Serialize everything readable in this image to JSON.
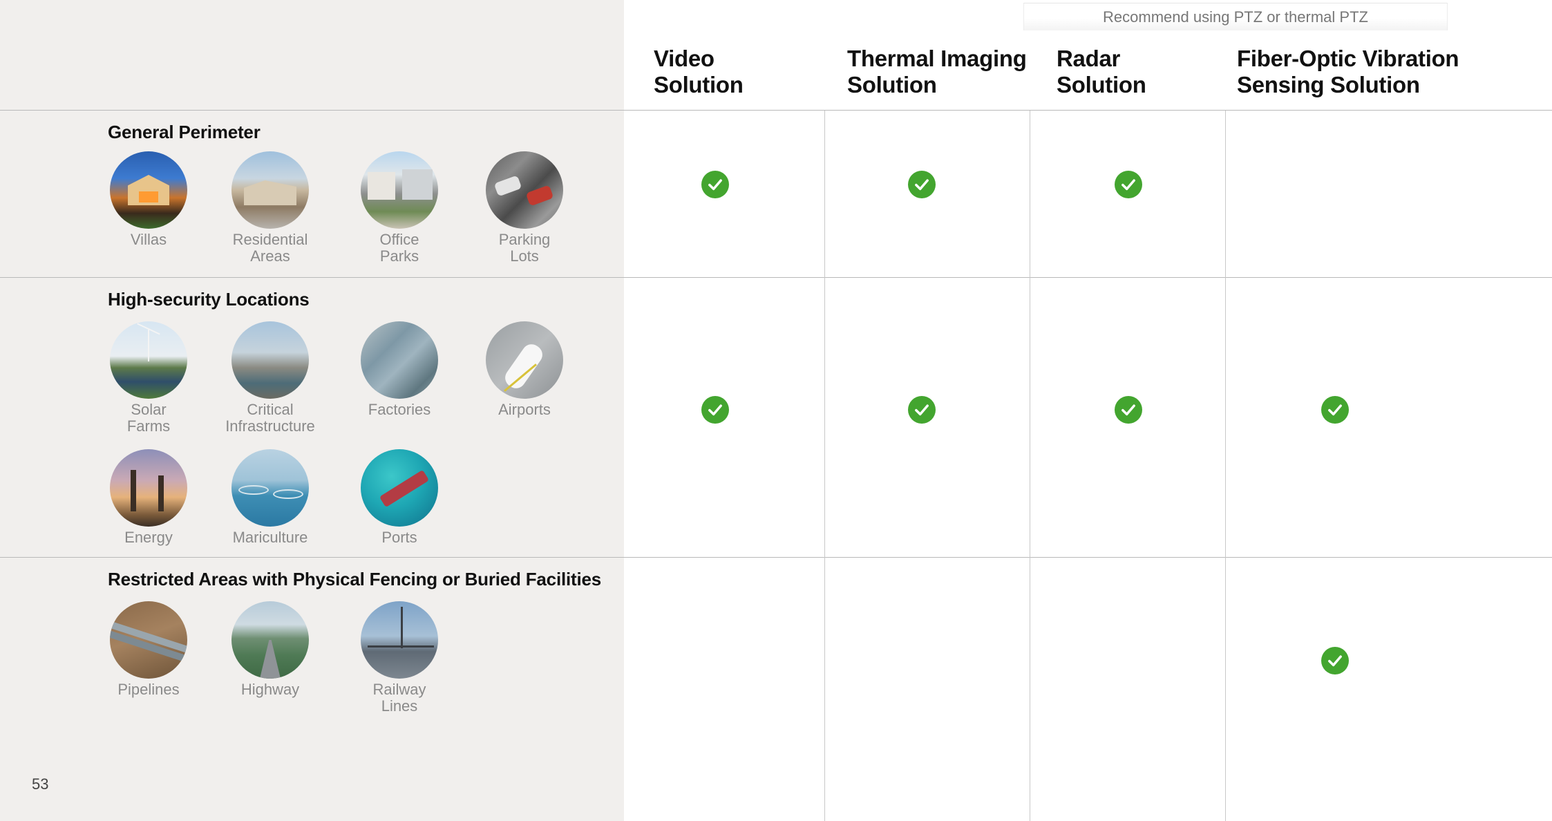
{
  "note": "Recommend using PTZ or thermal PTZ",
  "columns": [
    {
      "line1": "Video",
      "line2": "Solution"
    },
    {
      "line1": "Thermal Imaging",
      "line2": "Solution"
    },
    {
      "line1": "Radar",
      "line2": "Solution"
    },
    {
      "line1": "Fiber-Optic Vibration",
      "line2": "Sensing Solution"
    }
  ],
  "sections": [
    {
      "title": "General Perimeter",
      "places": [
        {
          "line1": "Villas",
          "line2": ""
        },
        {
          "line1": "Residential",
          "line2": "Areas"
        },
        {
          "line1": "Office",
          "line2": "Parks"
        },
        {
          "line1": "Parking",
          "line2": "Lots"
        }
      ],
      "support": [
        true,
        true,
        true,
        false
      ]
    },
    {
      "title": "High-security Locations",
      "places": [
        {
          "line1": "Solar",
          "line2": "Farms"
        },
        {
          "line1": "Critical",
          "line2": "Infrastructure"
        },
        {
          "line1": "Factories",
          "line2": ""
        },
        {
          "line1": "Airports",
          "line2": ""
        },
        {
          "line1": "Energy",
          "line2": ""
        },
        {
          "line1": "Mariculture",
          "line2": ""
        },
        {
          "line1": "Ports",
          "line2": ""
        }
      ],
      "support": [
        true,
        true,
        true,
        true
      ]
    },
    {
      "title": "Restricted Areas with Physical Fencing or Buried Facilities",
      "places": [
        {
          "line1": "Pipelines",
          "line2": ""
        },
        {
          "line1": "Highway",
          "line2": ""
        },
        {
          "line1": "Railway",
          "line2": "Lines"
        }
      ],
      "support": [
        false,
        false,
        false,
        true
      ]
    }
  ],
  "page_number": "53",
  "colors": {
    "check": "#43a52f",
    "left_panel": "#f1efed"
  }
}
